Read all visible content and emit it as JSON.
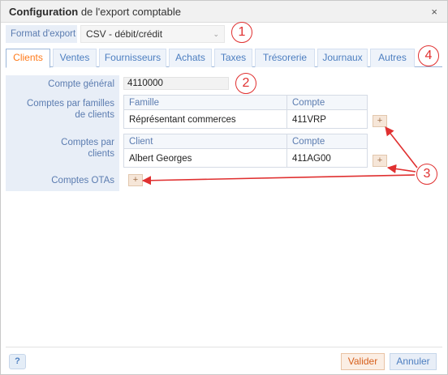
{
  "window": {
    "title_bold": "Configuration",
    "title_rest": " de l'export comptable",
    "close_glyph": "×"
  },
  "export": {
    "label": "Format d'export",
    "value": "CSV - débit/crédit",
    "chevron_glyph": "⌄"
  },
  "tabs": [
    {
      "label": "Clients",
      "active": true
    },
    {
      "label": "Ventes",
      "active": false
    },
    {
      "label": "Fournisseurs",
      "active": false
    },
    {
      "label": "Achats",
      "active": false
    },
    {
      "label": "Taxes",
      "active": false
    },
    {
      "label": "Trésorerie",
      "active": false
    },
    {
      "label": "Journaux",
      "active": false
    },
    {
      "label": "Autres",
      "active": false
    }
  ],
  "clients": {
    "compte_general_label": "Compte général",
    "compte_general_value": "4110000",
    "familles_label_line1": "Comptes par familles",
    "familles_label_line2": "de clients",
    "familles_table": {
      "columns": [
        "Famille",
        "Compte"
      ],
      "rows": [
        [
          "Réprésentant commerces",
          "411VRP"
        ]
      ]
    },
    "par_clients_label_line1": "Comptes par",
    "par_clients_label_line2": "clients",
    "clients_table": {
      "columns": [
        "Client",
        "Compte"
      ],
      "rows": [
        [
          "Albert Georges",
          "411AG00"
        ]
      ]
    },
    "otas_label": "Comptes OTAs",
    "add_glyph": "+"
  },
  "annotations": {
    "badge1": "1",
    "badge2": "2",
    "badge3": "3",
    "badge4": "4",
    "color": "#e03030"
  },
  "footer": {
    "help_glyph": "?",
    "validate_label": "Valider",
    "cancel_label": "Annuler"
  },
  "colors": {
    "accent_orange": "#ff7a1a",
    "label_blue": "#5b7cb0",
    "tab_blue": "#4c7ec0",
    "panel_bg": "#e8eef7"
  }
}
